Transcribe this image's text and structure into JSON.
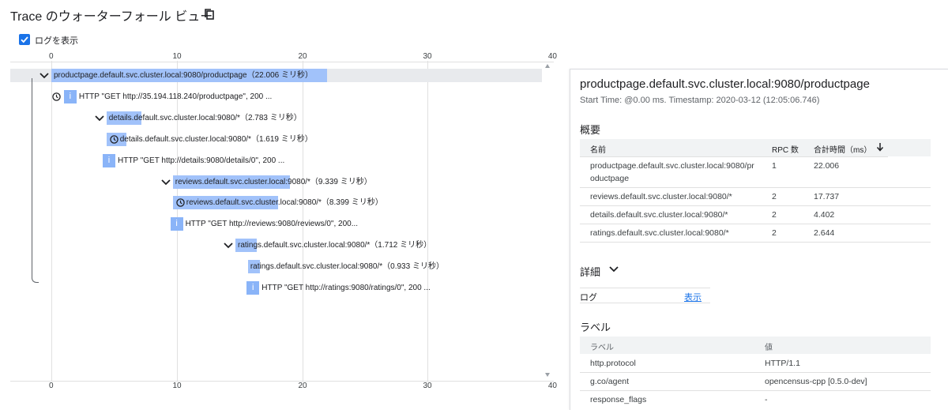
{
  "header": {
    "title": "Trace のウォーターフォール ビュー",
    "show_logs_label": "ログを表示",
    "show_logs_checked": true
  },
  "waterfall": {
    "axis_top": [
      "0",
      "10",
      "20",
      "30",
      "40"
    ],
    "axis_bottom": [
      "0",
      "10",
      "20",
      "30",
      "40"
    ],
    "axis_max_ms": 40,
    "rows": [
      {
        "text": "productpage.default.svc.cluster.local:9080/productpage（22.006 ミリ秒）",
        "start_ms": 0,
        "duration_ms": 22.006,
        "icon": "chevron-down-icon"
      },
      {
        "text": "HTTP \"GET http://35.194.118.240/productpage\", 200 ...",
        "start_ms": 1.0,
        "icon": "clock-icon",
        "kind": "log"
      },
      {
        "text": "details.default.svc.cluster.local:9080/*（2.783 ミリ秒）",
        "start_ms": 4.4,
        "duration_ms": 2.783,
        "icon": "chevron-down-icon"
      },
      {
        "text": "details.default.svc.cluster.local:9080/*（1.619 ミリ秒）",
        "start_ms": 4.4,
        "duration_ms": 1.619,
        "icon": "clock-icon"
      },
      {
        "text": "HTTP \"GET http://details:9080/details/0\", 200 ...",
        "start_ms": 4.1,
        "kind": "log"
      },
      {
        "text": "reviews.default.svc.cluster.local:9080/*（9.339 ミリ秒）",
        "start_ms": 9.7,
        "duration_ms": 9.339,
        "icon": "chevron-down-icon"
      },
      {
        "text": "reviews.default.svc.cluster.local:9080/*（8.399 ミリ秒）",
        "start_ms": 9.7,
        "duration_ms": 8.399,
        "icon": "clock-icon"
      },
      {
        "text": "HTTP \"GET http://reviews:9080/reviews/0\", 200...",
        "start_ms": 9.5,
        "kind": "log"
      },
      {
        "text": "ratings.default.svc.cluster.local:9080/*（1.712 ミリ秒）",
        "start_ms": 14.7,
        "duration_ms": 1.712,
        "icon": "chevron-down-icon"
      },
      {
        "text": "ratings.default.svc.cluster.local:9080/*（0.933 ミリ秒）",
        "start_ms": 15.7,
        "duration_ms": 0.933
      },
      {
        "text": "HTTP \"GET http://ratings:9080/ratings/0\", 200 ...",
        "start_ms": 15.6,
        "kind": "log"
      }
    ],
    "log_icon_glyph": "i"
  },
  "details_panel": {
    "title": "productpage.default.svc.cluster.local:9080/productpage",
    "subtitle": "Start Time: @0.00 ms. Timestamp: 2020-03-12 (12:05:06.746)",
    "summary_heading": "概要",
    "summary_columns": [
      "名前",
      "RPC 数",
      "合計時間（ms）"
    ],
    "summary_rows": [
      {
        "name_line1": "productpage.default.svc.cluster.local:9080/pr",
        "name_line2": "oductpage",
        "rpc": "1",
        "total": "22.006"
      },
      {
        "name_line1": "reviews.default.svc.cluster.local:9080/*",
        "name_line2": "",
        "rpc": "2",
        "total": "17.737"
      },
      {
        "name_line1": "details.default.svc.cluster.local:9080/*",
        "name_line2": "",
        "rpc": "2",
        "total": "4.402"
      },
      {
        "name_line1": "ratings.default.svc.cluster.local:9080/*",
        "name_line2": "",
        "rpc": "2",
        "total": "2.644"
      }
    ],
    "details_heading": "詳細",
    "log_label": "ログ",
    "log_link": "表示",
    "labels_heading": "ラベル",
    "labels_columns": [
      "ラベル",
      "値"
    ],
    "labels_rows": [
      {
        "key": "http.protocol",
        "value": "HTTP/1.1"
      },
      {
        "key": "g.co/agent",
        "value": "opencensus-cpp [0.5.0-dev]"
      },
      {
        "key": "response_flags",
        "value": "-"
      }
    ]
  },
  "colors": {
    "bar": "#a1c2fa",
    "log_marker": "#8ab4f8",
    "accent": "#1a73e8",
    "row_highlight": "#e8eaed"
  }
}
